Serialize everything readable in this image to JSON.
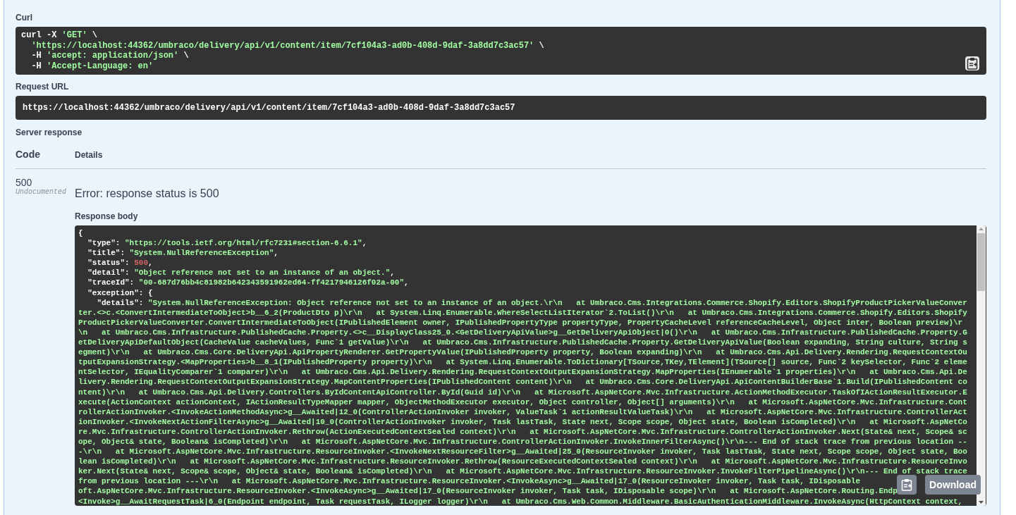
{
  "curl": {
    "label": "Curl",
    "lines": [
      [
        {
          "kind": "plain",
          "text": "curl -X "
        },
        {
          "kind": "string",
          "text": "'GET'"
        },
        {
          "kind": "plain",
          "text": " \\"
        }
      ],
      [
        {
          "kind": "string",
          "text": "'https://localhost:44362/umbraco/delivery/api/v1/content/item/7cf104a3-ad0b-408d-9daf-3a8dd7c3ac57'"
        },
        {
          "kind": "plain",
          "text": " \\"
        }
      ],
      [
        {
          "kind": "plain",
          "text": "-H "
        },
        {
          "kind": "string",
          "text": "'accept: application/json'"
        },
        {
          "kind": "plain",
          "text": " \\"
        }
      ],
      [
        {
          "kind": "plain",
          "text": "-H "
        },
        {
          "kind": "string",
          "text": "'Accept-Language: en'"
        }
      ]
    ]
  },
  "request_url": {
    "label": "Request URL",
    "value": "https://localhost:44362/umbraco/delivery/api/v1/content/item/7cf104a3-ad0b-408d-9daf-3a8dd7c3ac57"
  },
  "server_response": {
    "label": "Server response",
    "columns": [
      "Code",
      "Details"
    ],
    "code": "500",
    "code_note": "Undocumented",
    "error": "Error: response status is 500",
    "body_label": "Response body",
    "body": {
      "open": "{",
      "fields": [
        {
          "key": "\"type\":",
          "kind": "string",
          "value": "\"https://tools.ietf.org/html/rfc7231#section-6.6.1\"",
          "trail": ","
        },
        {
          "key": "\"title\":",
          "kind": "string",
          "value": "\"System.NullReferenceException\"",
          "trail": ","
        },
        {
          "key": "\"status\":",
          "kind": "number",
          "value": "500",
          "trail": ","
        },
        {
          "key": "\"detail\":",
          "kind": "string",
          "value": "\"Object reference not set to an instance of an object.\"",
          "trail": ","
        },
        {
          "key": "\"traceId\":",
          "kind": "string",
          "value": "\"00-687d76bb4c81982b642343591962ed64-ff4217946126f02a-00\"",
          "trail": ","
        },
        {
          "key": "\"exception\":",
          "kind": "object",
          "value": "{",
          "children": [
            {
              "key": "\"details\":",
              "kind": "text",
              "lines": [
                "\"System.NullReferenceException: Object reference not set to an instance of an object.\\r\\n   at Umbraco.Cms.Integrations.Commerce.Shopify.Editors.ShopifyProductPickerValueConver",
                "ter.<>c.<ConvertIntermediateToObject>b__6_2(ProductDto p)\\r\\n   at System.Linq.Enumerable.WhereSelectListIterator`2.ToList()\\r\\n   at Umbraco.Cms.Integrations.Commerce.Shopify.Editors.Shopify",
                "ProductPickerValueConverter.ConvertIntermediateToObject(IPublishedElement owner, IPublishedPropertyType propertyType, PropertyCacheLevel referenceCacheLevel, Object inter, Boolean preview)\\r",
                "\\n   at Umbraco.Cms.Infrastructure.PublishedCache.Property.<>c__DisplayClass25_0.<GetDeliveryApiValue>g__GetDeliveryApiObject|0()\\r\\n   at Umbraco.Cms.Infrastructure.PublishedCache.Property.G",
                "etDeliveryApiDefaultObject(CacheValue cacheValues, Func`1 getValue)\\r\\n   at Umbraco.Cms.Infrastructure.PublishedCache.Property.GetDeliveryApiValue(Boolean expanding, String culture, String s",
                "egment)\\r\\n   at Umbraco.Cms.Core.DeliveryApi.ApiPropertyRenderer.GetPropertyValue(IPublishedProperty property, Boolean expanding)\\r\\n   at Umbraco.Cms.Api.Delivery.Rendering.RequestContextOu",
                "tputExpansionStrategy.<MapProperties>b__8_1(IPublishedProperty property)\\r\\n   at System.Linq.Enumerable.ToDictionary[TSource,TKey,TElement](TSource[] source, Func`2 keySelector, Func`2 eleme",
                "ntSelector, IEqualityComparer`1 comparer)\\r\\n   at Umbraco.Cms.Api.Delivery.Rendering.RequestContextOutputExpansionStrategy.MapProperties(IEnumerable`1 properties)\\r\\n   at Umbraco.Cms.Api.De",
                "livery.Rendering.RequestContextOutputExpansionStrategy.MapContentProperties(IPublishedContent content)\\r\\n   at Umbraco.Cms.Core.DeliveryApi.ApiContentBuilderBase`1.Build(IPublishedContent co",
                "ntent)\\r\\n   at Umbraco.Cms.Api.Delivery.Controllers.ByIdContentApiController.ById(Guid id)\\r\\n   at Microsoft.AspNetCore.Mvc.Infrastructure.ActionMethodExecutor.TaskOfIActionResultExecutor.E",
                "xecute(ActionContext actionContext, IActionResultTypeMapper mapper, ObjectMethodExecutor executor, Object controller, Object[] arguments)\\r\\n   at Microsoft.AspNetCore.Mvc.Infrastructure.Cont",
                "rollerActionInvoker.<InvokeActionMethodAsync>g__Awaited|12_0(ControllerActionInvoker invoker, ValueTask`1 actionResultValueTask)\\r\\n   at Microsoft.AspNetCore.Mvc.Infrastructure.ControllerAct",
                "ionInvoker.<InvokeNextActionFilterAsync>g__Awaited|10_0(ControllerActionInvoker invoker, Task lastTask, State next, Scope scope, Object state, Boolean isCompleted)\\r\\n   at Microsoft.AspNetCo",
                "re.Mvc.Infrastructure.ControllerActionInvoker.Rethrow(ActionExecutedContextSealed context)\\r\\n   at Microsoft.AspNetCore.Mvc.Infrastructure.ControllerActionInvoker.Next(State& next, Scope& sc",
                "ope, Object& state, Boolean& isCompleted)\\r\\n   at Microsoft.AspNetCore.Mvc.Infrastructure.ControllerActionInvoker.InvokeInnerFilterAsync()\\r\\n--- End of stack trace from previous location --",
                "-\\r\\n   at Microsoft.AspNetCore.Mvc.Infrastructure.ResourceInvoker.<InvokeNextResourceFilter>g__Awaited|25_0(ResourceInvoker invoker, Task lastTask, State next, Scope scope, Object state, Boo",
                "lean isCompleted)\\r\\n   at Microsoft.AspNetCore.Mvc.Infrastructure.ResourceInvoker.Rethrow(ResourceExecutedContextSealed context)\\r\\n   at Microsoft.AspNetCore.Mvc.Infrastructure.ResourceInvo",
                "ker.Next(State& next, Scope& scope, Object& state, Boolean& isCompleted)\\r\\n   at Microsoft.AspNetCore.Mvc.Infrastructure.ResourceInvoker.InvokeFilterPipelineAsync()\\r\\n--- End of stack trace",
                "from previous location ---\\r\\n   at Microsoft.AspNetCore.Mvc.Infrastructure.ResourceInvoker.<InvokeAsync>g__Awaited|17_0(ResourceInvoker invoker, Task task, IDisposable",
                "oft.AspNetCore.Mvc.Infrastructure.ResourceInvoker.<InvokeAsync>g__Awaited|17_0(ResourceInvoker invoker, Task task, IDisposable scope)\\r\\n   at Microsoft.AspNetCore.Routing.Endp",
                "<Invoke>g__AwaitRequestTask|6_0(Endpoint endpoint, Task requestTask, ILogger logger)\\r\\n   at Umbraco.Cms.Web.Common.Middleware.BasicAuthenticationMiddleware.InvokeAsync(HttpContext context,"
              ]
            }
          ]
        }
      ]
    },
    "download": "Download"
  }
}
